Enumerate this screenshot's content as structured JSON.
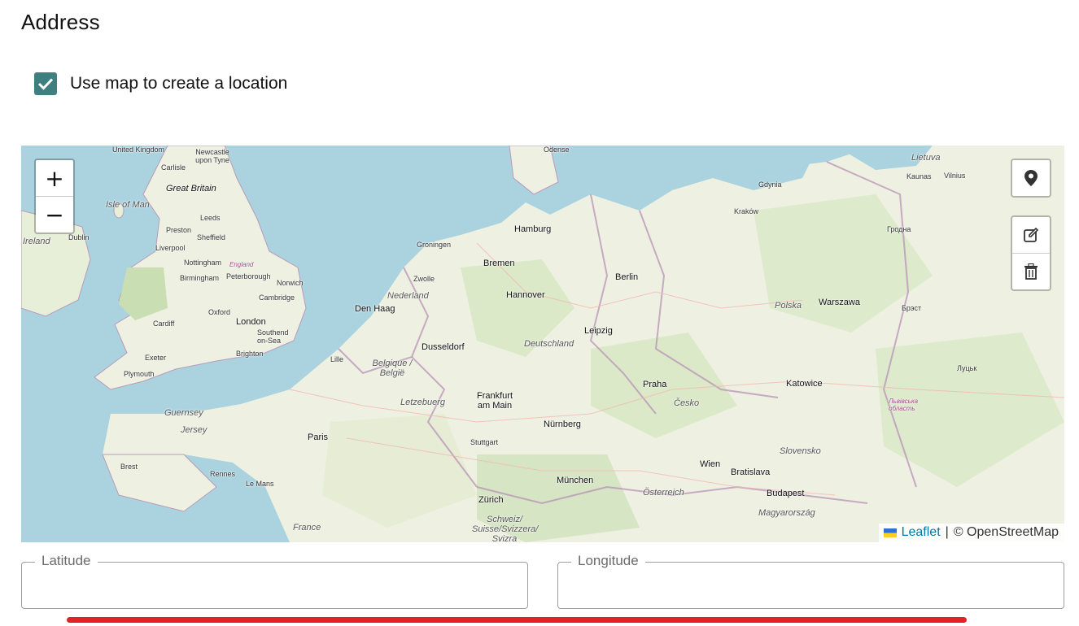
{
  "section": {
    "title": "Address"
  },
  "checkbox": {
    "label": "Use map to create a location",
    "checked": true,
    "color": "#3f7f7f"
  },
  "map": {
    "zoom_in_label": "+",
    "zoom_out_label": "−",
    "tools": [
      "marker-icon",
      "edit-icon",
      "trash-icon"
    ],
    "attribution": {
      "leaflet": "Leaflet",
      "separator": "|",
      "osm": "© OpenStreetMap"
    },
    "labels": {
      "united_kingdom": "United Kingdom",
      "newcastle": "Newcastle upon Tyne",
      "carlisle": "Carlisle",
      "great_britain": "Great Britain",
      "isle_of_man": "Isle of Man",
      "leeds": "Leeds",
      "preston": "Preston",
      "sheffield": "Sheffield",
      "liverpool": "Liverpool",
      "dublin": "Dublin",
      "ireland": "Ireland",
      "nottingham": "Nottingham",
      "birmingham": "Birmingham",
      "england": "England",
      "peterborough": "Peterborough",
      "norwich": "Norwich",
      "cambridge": "Cambridge",
      "oxford": "Oxford",
      "london": "London",
      "bristol_cardiff": "Cardiff",
      "southend": "Southend on-Sea",
      "brighton": "Brighton",
      "plymouth": "Plymouth",
      "exeter": "Exeter",
      "guernsey": "Guernsey",
      "jersey": "Jersey",
      "brest": "Brest",
      "rennes": "Rennes",
      "le_mans": "Le Mans",
      "paris": "Paris",
      "france": "France",
      "lille": "Lille",
      "bruxelles": "Belgique / België",
      "luxembourg": "Letzebuerg",
      "den_haag": "Den Haag",
      "nederland": "Nederland",
      "groningen": "Groningen",
      "amsterdam_area": "Zwolle",
      "bremen": "Bremen",
      "hamburg": "Hamburg",
      "hannover": "Hannover",
      "berlin": "Berlin",
      "dusseldorf": "Dusseldorf",
      "deutschland": "Deutschland",
      "leipzig": "Leipzig",
      "frankfurt": "Frankfurt am Main",
      "nurnberg": "Nürnberg",
      "munchen": "München",
      "stuttgart": "Stuttgart",
      "zurich": "Zürich",
      "schweiz": "Schweiz/ Suisse/Svizzera/ Svizra",
      "praha": "Praha",
      "cesko": "Česko",
      "wien": "Wien",
      "osterreich": "Österreich",
      "bratislava": "Bratislava",
      "budapest": "Budapest",
      "magyarorszag": "Magyarország",
      "slovensko": "Slovensko",
      "polska": "Polska",
      "warszawa": "Warszawa",
      "katowice": "Katowice",
      "krakow": "Kraków",
      "gdynia": "Gdynia",
      "lietuva": "Lietuva",
      "vilnius": "Vilnius",
      "kaunas": "Kaunas",
      "grodno": "Гродна",
      "brest_by": "Брэст",
      "lutsk": "Луцьк",
      "lviv": "Львівська область",
      "odense": "Odense"
    }
  },
  "fields": {
    "latitude": {
      "label": "Latitude",
      "value": ""
    },
    "longitude": {
      "label": "Longitude",
      "value": ""
    }
  }
}
